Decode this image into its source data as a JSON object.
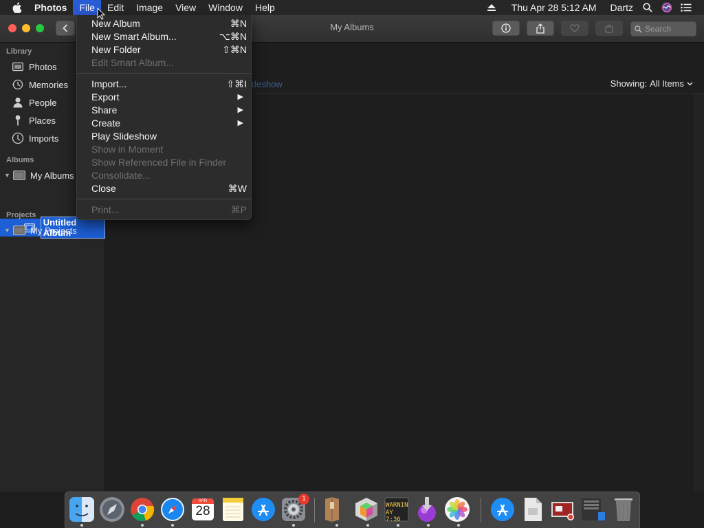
{
  "menubar": {
    "app_name": "Photos",
    "items": [
      "File",
      "Edit",
      "Image",
      "View",
      "Window",
      "Help"
    ],
    "active_item": "File",
    "clock": "Thu Apr 28  5:12 AM",
    "user": "Dartz"
  },
  "window": {
    "title": "My Albums",
    "search_placeholder": "Search"
  },
  "sidebar": {
    "library_header": "Library",
    "library_items": [
      {
        "label": "Photos",
        "icon": "photos-icon"
      },
      {
        "label": "Memories",
        "icon": "memories-icon"
      },
      {
        "label": "People",
        "icon": "people-icon"
      },
      {
        "label": "Places",
        "icon": "places-icon"
      },
      {
        "label": "Imports",
        "icon": "imports-icon"
      }
    ],
    "albums_header": "Albums",
    "my_albums": "My Albums",
    "untitled_album": "Untitled Album",
    "projects_header": "Projects",
    "my_projects": "My Projects"
  },
  "content": {
    "slideshow_fragment": "deshow",
    "showing_label": "Showing:",
    "showing_value": "All Items"
  },
  "file_menu": {
    "new_album": "New Album",
    "new_album_sc": "⌘N",
    "new_smart_album": "New Smart Album...",
    "new_smart_album_sc": "⌥⌘N",
    "new_folder": "New Folder",
    "new_folder_sc": "⇧⌘N",
    "edit_smart_album": "Edit Smart Album...",
    "import": "Import...",
    "import_sc": "⇧⌘I",
    "export": "Export",
    "share": "Share",
    "create": "Create",
    "play_slideshow": "Play Slideshow",
    "show_in_moment": "Show in Moment",
    "show_referenced": "Show Referenced File in Finder",
    "consolidate": "Consolidate...",
    "close": "Close",
    "close_sc": "⌘W",
    "print": "Print...",
    "print_sc": "⌘P"
  },
  "dock": {
    "calendar_month": "APR",
    "calendar_day": "28",
    "console_text_1": "WARNIN",
    "console_text_2": "AY 7:36",
    "settings_badge": "1"
  }
}
